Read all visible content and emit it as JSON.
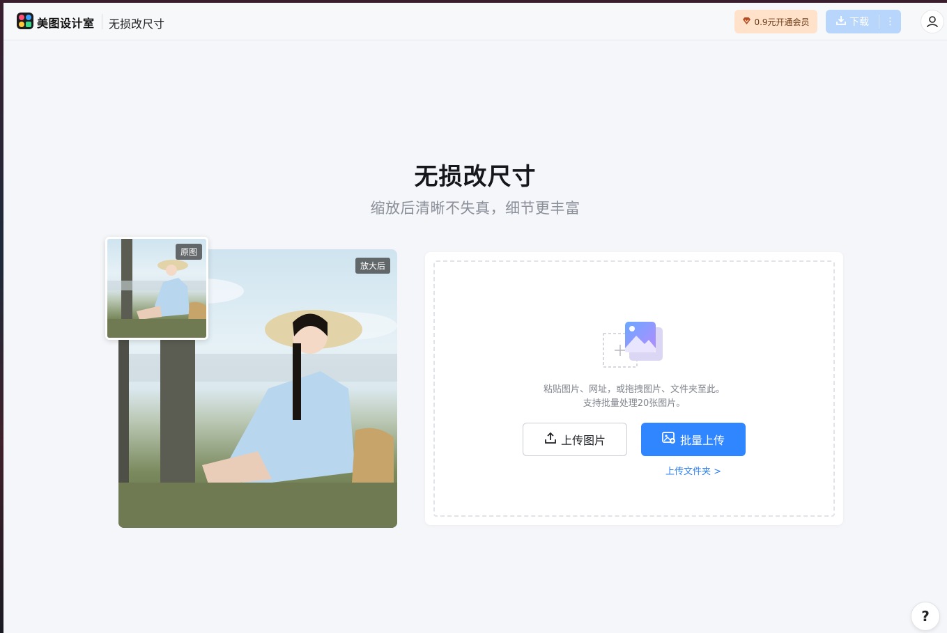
{
  "header": {
    "brand": "美图设计室",
    "tool_name": "无损改尺寸",
    "vip_label": "0.9元开通会员",
    "download_label": "下载",
    "more_glyph": "⋮"
  },
  "hero": {
    "title": "无损改尺寸",
    "subtitle": "缩放后清晰不失真，细节更丰富"
  },
  "demo": {
    "original_tag": "原图",
    "enlarged_tag": "放大后"
  },
  "upload": {
    "hint_line1": "粘贴图片、网址，或拖拽图片、文件夹至此。",
    "hint_line2": "支持批量处理20张图片。",
    "upload_button": "上传图片",
    "batch_button": "批量上传",
    "folder_link": "上传文件夹 >"
  },
  "help": {
    "glyph": "?"
  },
  "colors": {
    "primary": "#2f86ff",
    "vip_bg": "#ffe2c9",
    "download_bg": "#b8d6fb",
    "page_bg": "#f5f6f9"
  }
}
